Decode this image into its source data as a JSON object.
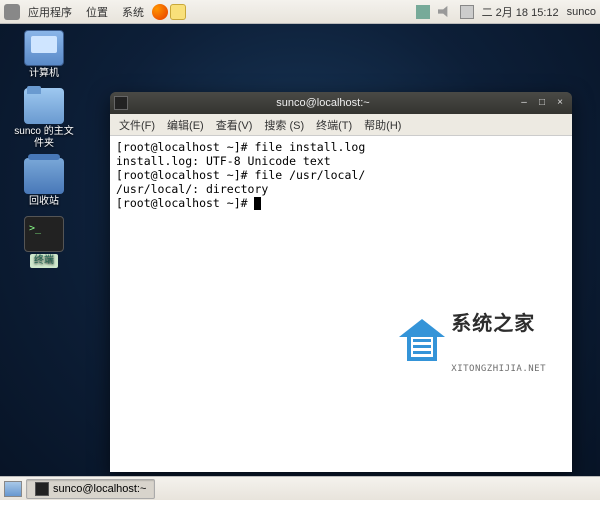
{
  "top_panel": {
    "menus": {
      "applications": "应用程序",
      "places": "位置",
      "system": "系统"
    },
    "clock": "二 2月 18 15:12",
    "user": "sunco"
  },
  "desktop_icons": {
    "computer": "计算机",
    "home": "sunco 的主文件夹",
    "trash": "回收站",
    "terminal_badge": "终端"
  },
  "terminal": {
    "title": "sunco@localhost:~",
    "menus": {
      "file": "文件(F)",
      "edit": "编辑(E)",
      "view": "查看(V)",
      "search": "搜索 (S)",
      "terminal": "终端(T)",
      "help": "帮助(H)"
    },
    "lines": [
      "[root@localhost ~]# file install.log",
      "install.log: UTF-8 Unicode text",
      "[root@localhost ~]# file /usr/local/",
      "/usr/local/: directory",
      "[root@localhost ~]# "
    ]
  },
  "watermark": {
    "cn": "系统之家",
    "en": "XITONGZHIJIA.NET"
  },
  "taskbar": {
    "task1": "sunco@localhost:~"
  }
}
